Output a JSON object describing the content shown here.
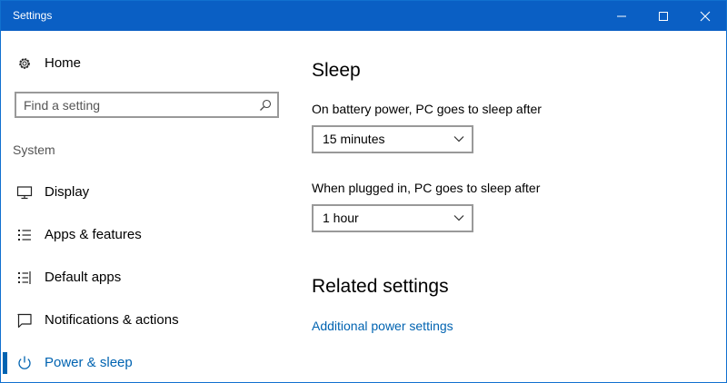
{
  "window": {
    "title": "Settings",
    "accent_color": "#0a5fc4",
    "controls": [
      "minimize-icon",
      "maximize-icon",
      "close-icon"
    ]
  },
  "sidebar": {
    "home": {
      "label": "Home",
      "icon": "gear-icon"
    },
    "search": {
      "placeholder": "Find a setting",
      "value": "",
      "icon": "search-icon"
    },
    "section_label": "System",
    "items": [
      {
        "label": "Display",
        "icon": "monitor-icon",
        "active": false
      },
      {
        "label": "Apps & features",
        "icon": "apps-list-icon",
        "active": false
      },
      {
        "label": "Default apps",
        "icon": "default-apps-icon",
        "active": false
      },
      {
        "label": "Notifications & actions",
        "icon": "notification-icon",
        "active": false
      },
      {
        "label": "Power & sleep",
        "icon": "power-icon",
        "active": true
      }
    ]
  },
  "main": {
    "sleep": {
      "heading": "Sleep",
      "battery_label": "On battery power, PC goes to sleep after",
      "battery_value": "15 minutes",
      "plugged_label": "When plugged in, PC goes to sleep after",
      "plugged_value": "1 hour"
    },
    "related": {
      "heading": "Related settings",
      "link": "Additional power settings",
      "link_color": "#0063b1"
    }
  }
}
